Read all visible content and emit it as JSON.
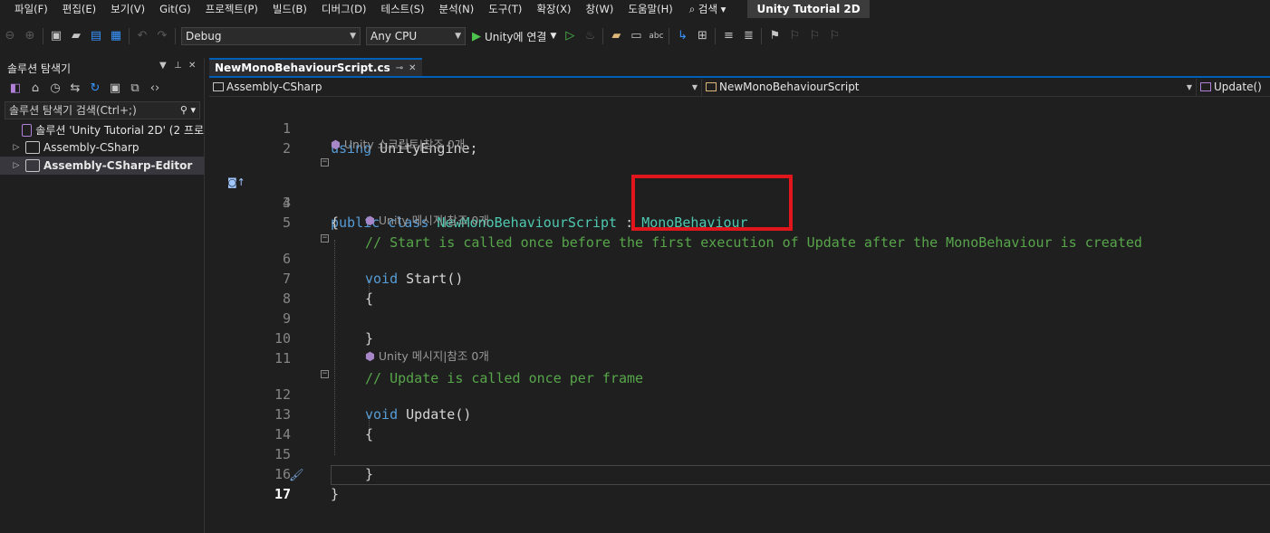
{
  "menu": {
    "items": [
      "파일(F)",
      "편집(E)",
      "보기(V)",
      "Git(G)",
      "프로젝트(P)",
      "빌드(B)",
      "디버그(D)",
      "테스트(S)",
      "분석(N)",
      "도구(T)",
      "확장(X)",
      "창(W)",
      "도움말(H)"
    ],
    "search_label": "⌕ 검색 ▾",
    "solution_name": "Unity Tutorial 2D"
  },
  "toolbar": {
    "config": "Debug",
    "platform": "Any CPU",
    "run_label": "Unity에 연결"
  },
  "solution_explorer": {
    "title": "솔루션 탐색기",
    "search_placeholder": "솔루션 탐색기 검색(Ctrl+;)",
    "items": [
      {
        "label": "솔루션 'Unity Tutorial 2D'  (2 프로"
      },
      {
        "label": "Assembly-CSharp"
      },
      {
        "label": "Assembly-CSharp-Editor"
      }
    ]
  },
  "editor": {
    "tab_name": "NewMonoBehaviourScript.cs",
    "nav": {
      "project": "Assembly-CSharp",
      "type": "NewMonoBehaviourScript",
      "member": "Update()"
    },
    "lens": {
      "class": "Unity 스크립트|참조 0개",
      "start": "Unity 메시지|참조 0개",
      "update": "Unity 메시지|참조 0개"
    },
    "line_numbers": [
      "1",
      "2",
      "3",
      "4",
      "5",
      "6",
      "7",
      "8",
      "9",
      "10",
      "11",
      "12",
      "13",
      "14",
      "15",
      "16",
      "17"
    ],
    "code": {
      "l1_kw": "using",
      "l1_rest": " UnityEngine;",
      "l3_kw": "public class",
      "l3_type": "NewMonoBehaviourScript",
      "l3_colon": " : ",
      "l3_base": "MonoBehaviour",
      "l4": "{",
      "l5": "// Start is called once before the first execution of Update after the MonoBehaviour is created",
      "l6_kw": "void",
      "l6_name": "Start",
      "l6_rest": "()",
      "l7": "{",
      "l9": "}",
      "l11": "// Update is called once per frame",
      "l12_kw": "void",
      "l12_name": "Update",
      "l12_rest": "()",
      "l13": "{",
      "l15": "}",
      "l16": "}"
    }
  }
}
